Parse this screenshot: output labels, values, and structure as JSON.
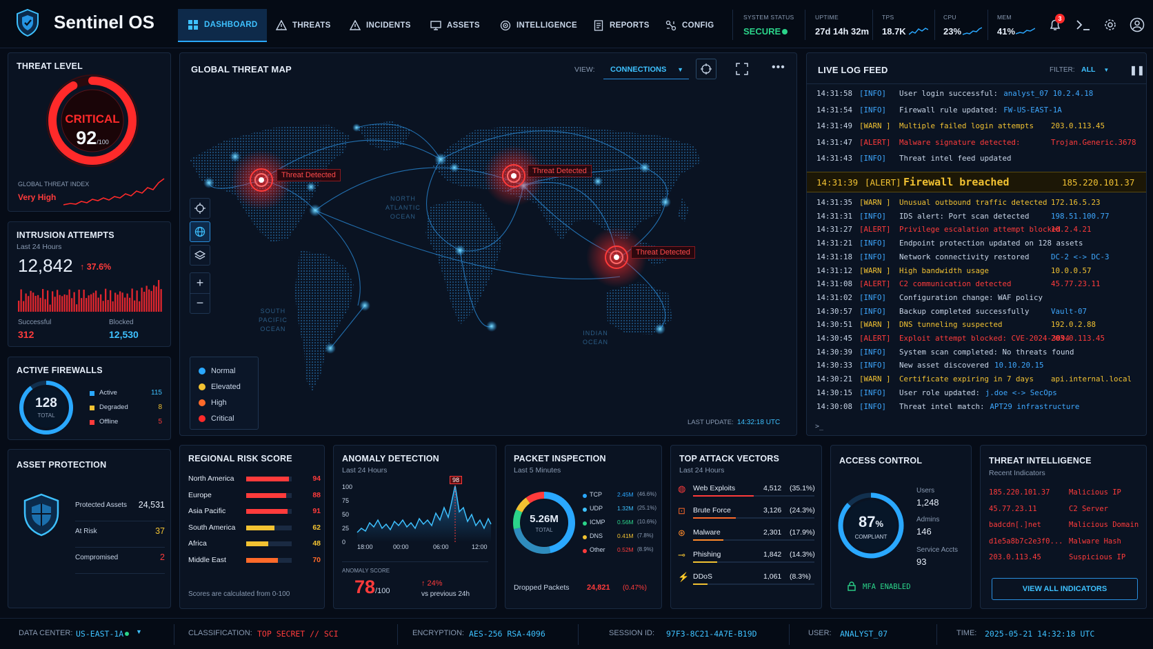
{
  "app": {
    "title": "Sentinel OS"
  },
  "nav": [
    {
      "label": "DASHBOARD",
      "icon": "dashboard-icon"
    },
    {
      "label": "THREATS",
      "icon": "warning-icon"
    },
    {
      "label": "INCIDENTS",
      "icon": "alert-icon"
    },
    {
      "label": "ASSETS",
      "icon": "monitor-icon"
    },
    {
      "label": "INTELLIGENCE",
      "icon": "target-icon"
    },
    {
      "label": "REPORTS",
      "icon": "report-icon"
    },
    {
      "label": "CONFIG",
      "icon": "config-icon"
    }
  ],
  "status": {
    "system_label": "SYSTEM STATUS",
    "system_value": "SECURE",
    "uptime_label": "UPTIME",
    "uptime_value": "27d 14h 32m",
    "tps_label": "TPS",
    "tps_value": "18.7K",
    "cpu_label": "CPU",
    "cpu_value": "23%",
    "mem_label": "MEM",
    "mem_value": "41%",
    "notifications": "3"
  },
  "threat_level": {
    "title": "THREAT LEVEL",
    "level": "CRITICAL",
    "score": "92",
    "score_max": "/100",
    "score_fraction": 0.92,
    "index_label": "GLOBAL THREAT INDEX",
    "index_value": "Very High"
  },
  "intrusion": {
    "title": "INTRUSION ATTEMPTS",
    "subtitle": "Last 24 Hours",
    "total": "12,842",
    "change": "↑ 37.6%",
    "successful_label": "Successful",
    "successful_value": "312",
    "blocked_label": "Blocked",
    "blocked_value": "12,530"
  },
  "firewalls": {
    "title": "ACTIVE FIREWALLS",
    "total": "128",
    "total_label": "TOTAL",
    "items": [
      {
        "label": "Active",
        "value": "115",
        "color": "#2aa8ff"
      },
      {
        "label": "Degraded",
        "value": "8",
        "color": "#f2c232"
      },
      {
        "label": "Offline",
        "value": "5",
        "color": "#ff3b3b"
      }
    ]
  },
  "asset_protection": {
    "title": "ASSET PROTECTION",
    "rows": [
      {
        "label": "Protected Assets",
        "value": "24,531",
        "color": "#e6eef9"
      },
      {
        "label": "At Risk",
        "value": "37",
        "color": "#f2c232"
      },
      {
        "label": "Compromised",
        "value": "2",
        "color": "#ff3b3b"
      }
    ]
  },
  "map": {
    "title": "GLOBAL THREAT MAP",
    "view_label": "VIEW:",
    "view_value": "CONNECTIONS",
    "threat_label": "Threat Detected",
    "oceans": [
      "NORTH\nATLANTIC\nOCEAN",
      "SOUTH\nPACIFIC\nOCEAN",
      "INDIAN\nOCEAN"
    ],
    "legend": [
      {
        "label": "Normal",
        "color": "#2aa8ff"
      },
      {
        "label": "Elevated",
        "color": "#f2c232"
      },
      {
        "label": "High",
        "color": "#ff6a2a"
      },
      {
        "label": "Critical",
        "color": "#ff2a2a"
      }
    ],
    "last_update_label": "LAST UPDATE:",
    "last_update_value": "14:32:18 UTC"
  },
  "log": {
    "title": "LIVE LOG FEED",
    "filter_label": "FILTER:",
    "filter_value": "ALL",
    "highlight": {
      "time": "14:31:39",
      "level": "[ALERT]",
      "msg": "Firewall breached",
      "extra": "185.220.101.37"
    },
    "rows_top": [
      {
        "time": "14:31:58",
        "level": "[INFO]",
        "msg": "User login successful:",
        "extra": "analyst_07  10.2.4.18",
        "type": "info"
      },
      {
        "time": "14:31:54",
        "level": "[INFO]",
        "msg": "Firewall rule updated:",
        "extra": "FW-US-EAST-1A",
        "type": "info"
      },
      {
        "time": "14:31:49",
        "level": "[WARN ]",
        "msg": "Multiple failed login attempts",
        "extra": "203.0.113.45",
        "type": "warn"
      },
      {
        "time": "14:31:47",
        "level": "[ALERT]",
        "msg": "Malware signature detected:",
        "extra": "Trojan.Generic.3678",
        "type": "alert"
      },
      {
        "time": "14:31:43",
        "level": "[INFO]",
        "msg": "Threat intel feed updated",
        "extra": "",
        "type": "info"
      }
    ],
    "rows_bottom": [
      {
        "time": "14:31:35",
        "level": "[WARN ]",
        "msg": "Unusual outbound traffic detected",
        "extra": "172.16.5.23",
        "type": "warn"
      },
      {
        "time": "14:31:31",
        "level": "[INFO]",
        "msg": "IDS alert: Port scan detected",
        "extra": "198.51.100.77",
        "type": "info"
      },
      {
        "time": "14:31:27",
        "level": "[ALERT]",
        "msg": "Privilege escalation attempt blocked",
        "extra": "10.2.4.21",
        "type": "alert"
      },
      {
        "time": "14:31:21",
        "level": "[INFO]",
        "msg": "Endpoint protection updated on 128 assets",
        "extra": "",
        "type": "info"
      },
      {
        "time": "14:31:18",
        "level": "[INFO]",
        "msg": "Network connectivity restored",
        "extra": "DC-2  <->  DC-3",
        "type": "info"
      },
      {
        "time": "14:31:12",
        "level": "[WARN ]",
        "msg": "High bandwidth usage",
        "extra": "10.0.0.57",
        "type": "warn"
      },
      {
        "time": "14:31:08",
        "level": "[ALERT]",
        "msg": "C2 communication detected",
        "extra": "45.77.23.11",
        "type": "alert"
      },
      {
        "time": "14:31:02",
        "level": "[INFO]",
        "msg": "Configuration change: WAF policy",
        "extra": "",
        "type": "info"
      },
      {
        "time": "14:30:57",
        "level": "[INFO]",
        "msg": "Backup completed successfully",
        "extra": "Vault-07",
        "type": "info"
      },
      {
        "time": "14:30:51",
        "level": "[WARN ]",
        "msg": "DNS tunneling suspected",
        "extra": "192.0.2.88",
        "type": "warn"
      },
      {
        "time": "14:30:45",
        "level": "[ALERT]",
        "msg": "Exploit attempt blocked: CVE-2024-3094",
        "extra": "203.0.113.45",
        "type": "alert"
      },
      {
        "time": "14:30:39",
        "level": "[INFO]",
        "msg": "System scan completed: No threats found",
        "extra": "",
        "type": "info"
      },
      {
        "time": "14:30:33",
        "level": "[INFO]",
        "msg": "New asset discovered",
        "extra": "10.10.20.15",
        "type": "info"
      },
      {
        "time": "14:30:21",
        "level": "[WARN ]",
        "msg": "Certificate expiring in 7 days",
        "extra": "api.internal.local",
        "type": "warn"
      },
      {
        "time": "14:30:15",
        "level": "[INFO]",
        "msg": "User role updated:",
        "extra": "j.doe <-> SecOps",
        "type": "info"
      },
      {
        "time": "14:30:08",
        "level": "[INFO]",
        "msg": "Threat intel match:",
        "extra": "APT29  infrastructure",
        "type": "info"
      }
    ],
    "prompt": ">_"
  },
  "regional": {
    "title": "REGIONAL RISK SCORE",
    "rows": [
      {
        "label": "North America",
        "value": "94",
        "score": 94,
        "color": "#ff3b3b"
      },
      {
        "label": "Europe",
        "value": "88",
        "score": 88,
        "color": "#ff3b3b"
      },
      {
        "label": "Asia Pacific",
        "value": "91",
        "score": 91,
        "color": "#ff3b3b"
      },
      {
        "label": "South America",
        "value": "62",
        "score": 62,
        "color": "#f2c232"
      },
      {
        "label": "Africa",
        "value": "48",
        "score": 48,
        "color": "#f2c232"
      },
      {
        "label": "Middle East",
        "value": "70",
        "score": 70,
        "color": "#ff6a2a"
      }
    ],
    "footer": "Scores are calculated from 0-100"
  },
  "anomaly": {
    "title": "ANOMALY DETECTION",
    "subtitle": "Last 24 Hours",
    "y_ticks": [
      "100",
      "75",
      "50",
      "25",
      "0"
    ],
    "x_ticks": [
      "18:00",
      "00:00",
      "06:00",
      "12:00"
    ],
    "peak_label": "98",
    "score_label": "ANOMALY SCORE",
    "score": "78",
    "score_max": "/100",
    "change": "↑ 24%",
    "change_note": "vs previous 24h"
  },
  "packet": {
    "title": "PACKET INSPECTION",
    "subtitle": "Last 5 Minutes",
    "total": "5.26M",
    "total_label": "TOTAL",
    "rows": [
      {
        "label": "TCP",
        "value": "2.45M",
        "pct": "(46.6%)",
        "color": "#2aa8ff"
      },
      {
        "label": "UDP",
        "value": "1.32M",
        "pct": "(25.1%)",
        "color": "#3ec1ff"
      },
      {
        "label": "ICMP",
        "value": "0.56M",
        "pct": "(10.6%)",
        "color": "#2bd48a"
      },
      {
        "label": "DNS",
        "value": "0.41M",
        "pct": "(7.8%)",
        "color": "#f2c232"
      },
      {
        "label": "Other",
        "value": "0.52M",
        "pct": "(8.9%)",
        "color": "#ff3b3b"
      }
    ],
    "dropped_label": "Dropped Packets",
    "dropped_value": "24,821",
    "dropped_pct": "(0.47%)"
  },
  "vectors": {
    "title": "TOP ATTACK VECTORS",
    "subtitle": "Last 24 Hours",
    "rows": [
      {
        "label": "Web Exploits",
        "value": "4,512",
        "pct": "(35.1%)",
        "icon": "web-icon",
        "color": "#ff3b3b",
        "share": 0.351
      },
      {
        "label": "Brute Force",
        "value": "3,126",
        "pct": "(24.3%)",
        "icon": "lock-icon",
        "color": "#ff6a2a",
        "share": 0.243
      },
      {
        "label": "Malware",
        "value": "2,301",
        "pct": "(17.9%)",
        "icon": "bug-icon",
        "color": "#ff8a2a",
        "share": 0.179
      },
      {
        "label": "Phishing",
        "value": "1,842",
        "pct": "(14.3%)",
        "icon": "hook-icon",
        "color": "#f2c232",
        "share": 0.143
      },
      {
        "label": "DDoS",
        "value": "1,061",
        "pct": "(8.3%)",
        "icon": "bolt-icon",
        "color": "#f2c232",
        "share": 0.083
      }
    ]
  },
  "access": {
    "title": "ACCESS CONTROL",
    "percent": "87",
    "percent_sign": "%",
    "percent_value": 0.87,
    "compliant": "COMPLIANT",
    "users_label": "Users",
    "users_value": "1,248",
    "admins_label": "Admins",
    "admins_value": "146",
    "service_label": "Service Accts",
    "service_value": "93",
    "mfa": "MFA ENABLED"
  },
  "intel": {
    "title": "THREAT INTELLIGENCE",
    "subtitle": "Recent Indicators",
    "rows": [
      {
        "indicator": "185.220.101.37",
        "type": "Malicious IP"
      },
      {
        "indicator": "45.77.23.11",
        "type": "C2 Server"
      },
      {
        "indicator": "badcdn[.]net",
        "type": "Malicious Domain"
      },
      {
        "indicator": "d1e5a8b7c2e3f0...",
        "type": "Malware Hash"
      },
      {
        "indicator": "203.0.113.45",
        "type": "Suspicious IP"
      }
    ],
    "button": "VIEW ALL INDICATORS"
  },
  "statusbar": {
    "dc_label": "DATA CENTER:",
    "dc_value": "US-EAST-1A",
    "class_label": "CLASSIFICATION:",
    "class_value": "TOP SECRET  //  SCI",
    "enc_label": "ENCRYPTION:",
    "enc_value": "AES-256  RSA-4096",
    "session_label": "SESSION ID:",
    "session_value": "97F3-8C21-4A7E-B19D",
    "user_label": "USER:",
    "user_value": "ANALYST_07",
    "time_label": "TIME:",
    "time_value": "2025-05-21  14:32:18  UTC"
  }
}
